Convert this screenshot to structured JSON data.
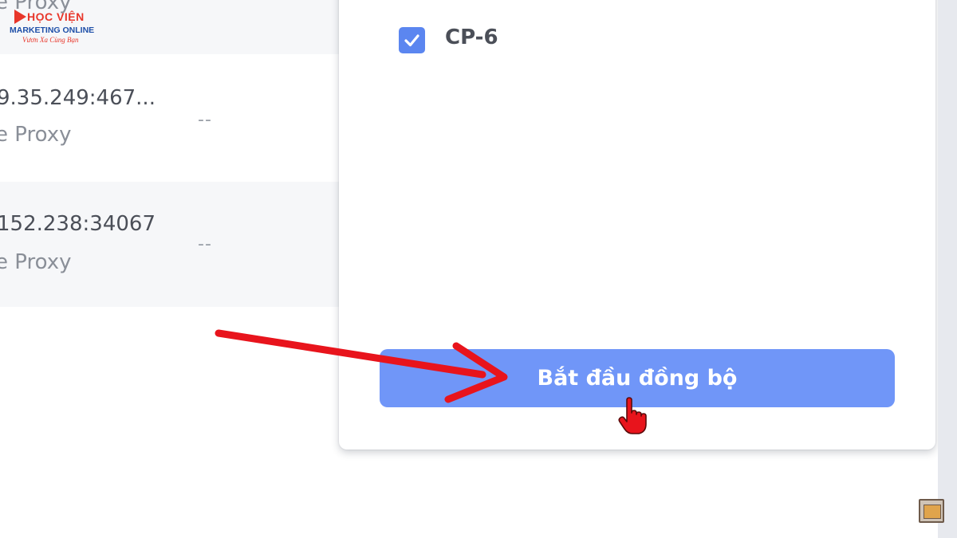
{
  "logo": {
    "line1": "HỌC VIỆN",
    "line2": "MARKETING ONLINE",
    "line3": "Vươn Xa Cùng Bạn"
  },
  "proxy_list": [
    {
      "address": "",
      "type": "e Proxy",
      "status": ""
    },
    {
      "address": "9.35.249:467...",
      "type": "e Proxy",
      "status": "--"
    },
    {
      "address": "152.238:34067",
      "type": "e Proxy",
      "status": "--"
    }
  ],
  "sync_panel": {
    "options": [
      {
        "label": "CP-6",
        "checked": true
      }
    ],
    "start_button": "Bắt đầu đồng bộ"
  },
  "colors": {
    "accent": "#7096f8",
    "checkbox": "#5b86f0",
    "annotation_arrow": "#e8141c"
  },
  "icons": [
    "check-icon",
    "hand-pointer-icon",
    "annotation-arrow-icon",
    "film-icon"
  ]
}
